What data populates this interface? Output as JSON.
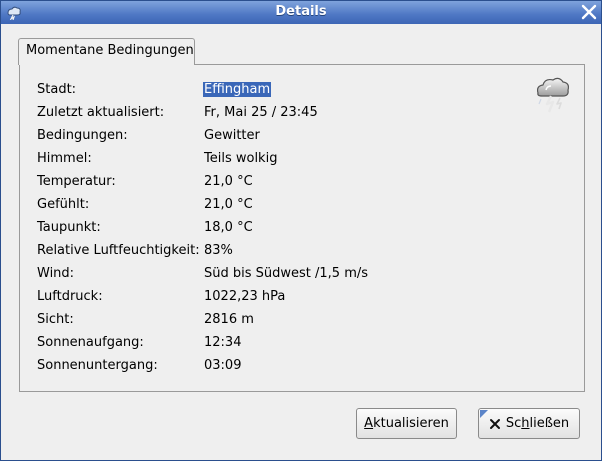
{
  "window": {
    "title": "Details"
  },
  "tabs": [
    {
      "label": "Momentane Bedingungen",
      "active": true
    }
  ],
  "conditions": [
    {
      "label": "Stadt:",
      "value": "Effingham",
      "selected": true
    },
    {
      "label": "Zuletzt aktualisiert:",
      "value": "Fr, Mai 25 / 23:45"
    },
    {
      "label": "Bedingungen:",
      "value": "Gewitter"
    },
    {
      "label": "Himmel:",
      "value": "Teils wolkig"
    },
    {
      "label": "Temperatur:",
      "value": "21,0 °C"
    },
    {
      "label": "Gefühlt:",
      "value": "21,0 °C"
    },
    {
      "label": "Taupunkt:",
      "value": "18,0 °C"
    },
    {
      "label": "Relative Luftfeuchtigkeit:",
      "value": "83%"
    },
    {
      "label": "Wind:",
      "value": "Süd bis Südwest /1,5 m/s"
    },
    {
      "label": "Luftdruck:",
      "value": "1022,23 hPa"
    },
    {
      "label": "Sicht:",
      "value": "2816 m"
    },
    {
      "label": "Sonnenaufgang:",
      "value": "12:34"
    },
    {
      "label": "Sonnenuntergang:",
      "value": "03:09"
    }
  ],
  "buttons": {
    "refresh": {
      "label_prefix": "",
      "mnemonic": "A",
      "label_rest": "ktualisieren"
    },
    "close": {
      "label_prefix": "Sc",
      "mnemonic": "h",
      "label_rest": "ließen"
    }
  },
  "icons": {
    "weather": "thunderstorm-icon",
    "close_button": "x-icon",
    "window": "weather-app-icon"
  },
  "colors": {
    "titlebar": "#4e77c4",
    "selection": "#3a67b8"
  }
}
